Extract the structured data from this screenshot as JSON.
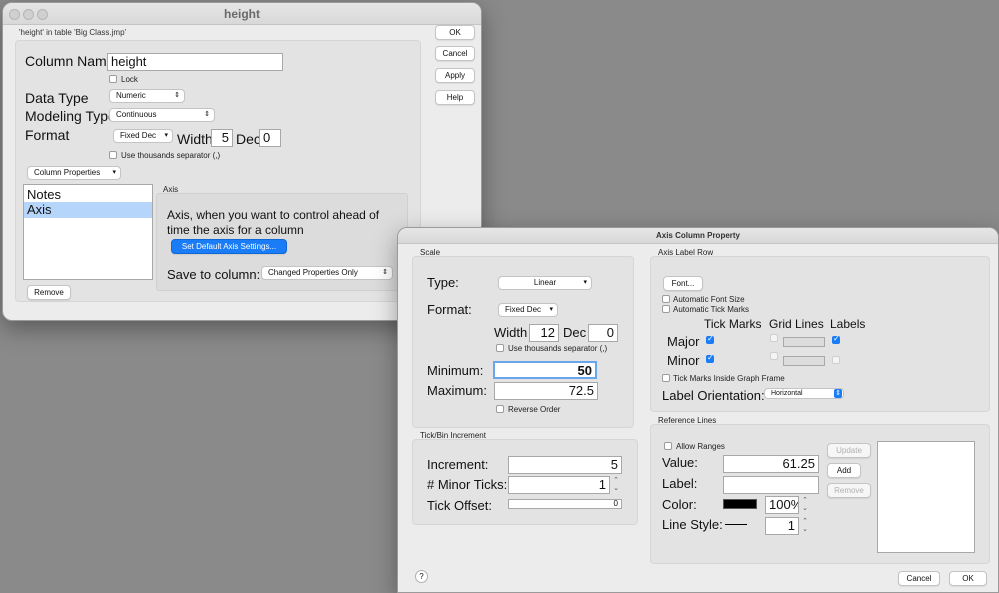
{
  "column_info": {
    "title": "height",
    "subtitle": "'height' in table 'Big Class.jmp'",
    "column_name_label": "Column Name",
    "column_name_value": "height",
    "lock_label": "Lock",
    "data_type_label": "Data Type",
    "data_type_value": "Numeric",
    "modeling_type_label": "Modeling Type",
    "modeling_type_value": "Continuous",
    "format_label": "Format",
    "format_value": "Fixed Dec",
    "width_label": "Width",
    "width_value": "5",
    "dec_label": "Dec",
    "dec_value": "0",
    "thousands_label": "Use thousands separator (,)",
    "column_properties_label": "Column Properties",
    "properties_list": [
      "Notes",
      "Axis"
    ],
    "selected_property": "Axis",
    "axis_section_label": "Axis",
    "axis_description": "Axis, when you want to control ahead of time the axis for a column",
    "set_default_button": "Set Default Axis Settings...",
    "save_to_column_label": "Save to column:",
    "save_to_column_value": "Changed Properties Only",
    "remove_button": "Remove",
    "buttons": {
      "ok": "OK",
      "cancel": "Cancel",
      "apply": "Apply",
      "help": "Help"
    }
  },
  "axis_property": {
    "title": "Axis Column Property",
    "scale": {
      "section_label": "Scale",
      "type_label": "Type:",
      "type_value": "Linear",
      "format_label": "Format:",
      "format_value": "Fixed Dec",
      "width_label": "Width",
      "width_value": "12",
      "dec_label": "Dec",
      "dec_value": "0",
      "thousands_label": "Use thousands separator (,)",
      "minimum_label": "Minimum:",
      "minimum_value": "50",
      "maximum_label": "Maximum:",
      "maximum_value": "72.5",
      "reverse_order_label": "Reverse Order"
    },
    "tick": {
      "section_label": "Tick/Bin Increment",
      "increment_label": "Increment:",
      "increment_value": "5",
      "minor_ticks_label": "# Minor Ticks:",
      "minor_ticks_value": "1",
      "tick_offset_label": "Tick Offset:",
      "tick_offset_value": "0"
    },
    "axis_label_row": {
      "section_label": "Axis Label Row",
      "font_button": "Font...",
      "auto_font_size_label": "Automatic Font Size",
      "auto_tick_marks_label": "Automatic Tick Marks",
      "tick_marks_header": "Tick Marks",
      "grid_lines_header": "Grid Lines",
      "labels_header": "Labels",
      "major_label": "Major",
      "minor_label": "Minor",
      "tick_inside_label": "Tick Marks Inside Graph Frame",
      "label_orientation_label": "Label Orientation:",
      "label_orientation_value": "Horizontal"
    },
    "reference_lines": {
      "section_label": "Reference Lines",
      "allow_ranges_label": "Allow Ranges",
      "value_label": "Value:",
      "value_value": "61.25",
      "label_label": "Label:",
      "label_value": "",
      "color_label": "Color:",
      "color_hex": "#000000",
      "opacity_value": "100%",
      "line_style_label": "Line Style:",
      "line_width_value": "1",
      "update_button": "Update",
      "add_button": "Add",
      "remove_button": "Remove"
    },
    "help_glyph": "?",
    "cancel_button": "Cancel",
    "ok_button": "OK"
  },
  "colors": {
    "accent": "#1a7cf6",
    "window_bg": "#ececec",
    "panel_bg": "#e3e3e3",
    "selection": "#b5d5fb"
  }
}
